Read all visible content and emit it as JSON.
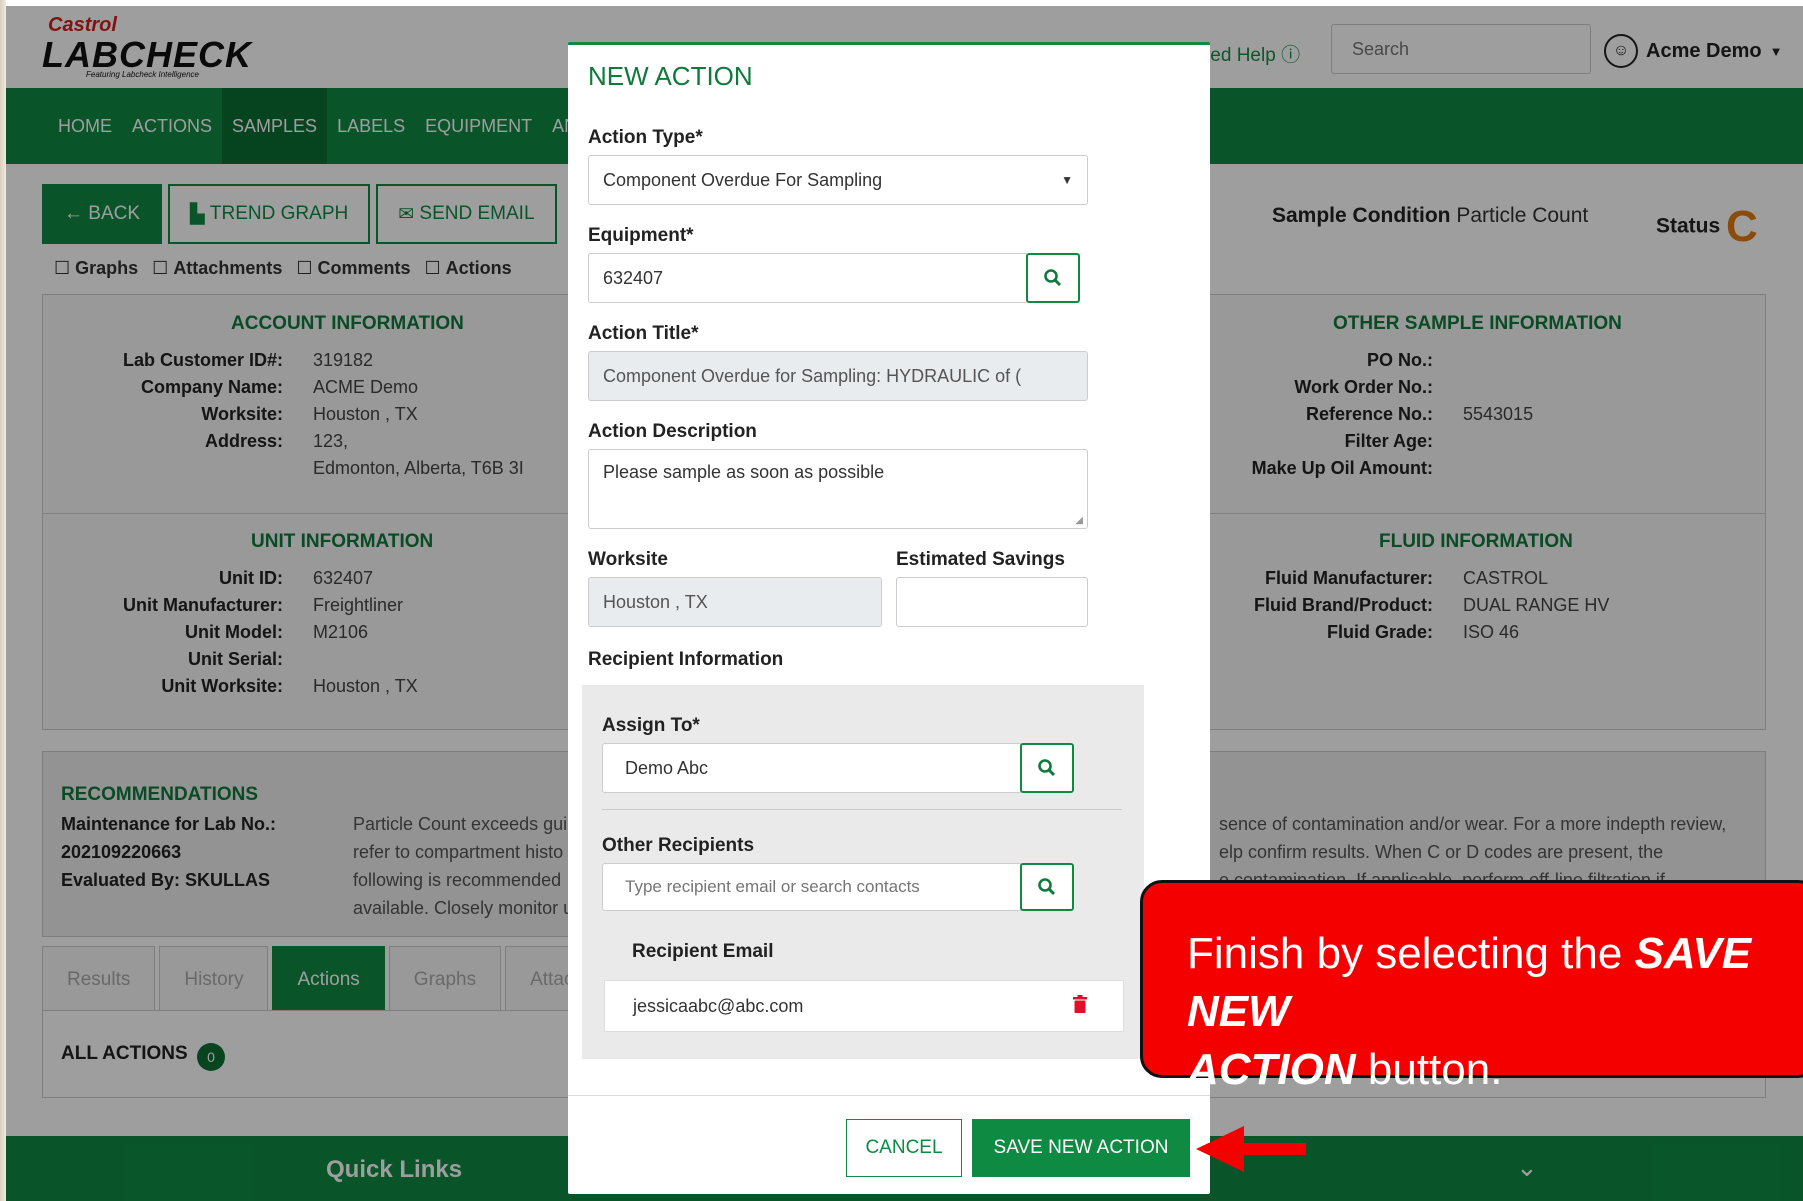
{
  "header": {
    "brand_top": "Castrol",
    "brand_main": "LABCHECK",
    "brand_sub": "Featuring Labcheck Intelligence",
    "help_label": "Need Help",
    "search_placeholder": "Search",
    "user_name": "Acme Demo"
  },
  "nav": {
    "items": [
      "HOME",
      "ACTIONS",
      "SAMPLES",
      "LABELS",
      "EQUIPMENT",
      "ANALY"
    ],
    "active": "SAMPLES"
  },
  "toolbar": {
    "back": "BACK",
    "trend": "TREND GRAPH",
    "email": "SEND EMAIL"
  },
  "filters": {
    "graphs": "Graphs",
    "attachments": "Attachments",
    "comments": "Comments",
    "actions": "Actions"
  },
  "sample": {
    "condition_label": "Sample Condition",
    "condition_value": "Particle Count",
    "status_label": "Status",
    "status_code": "C"
  },
  "account": {
    "title": "ACCOUNT INFORMATION",
    "rows": [
      {
        "k": "Lab Customer ID#:",
        "v": "319182"
      },
      {
        "k": "Company Name:",
        "v": "ACME Demo"
      },
      {
        "k": "Worksite:",
        "v": "Houston , TX"
      },
      {
        "k": "Address:",
        "v": "123,"
      },
      {
        "k": "",
        "v": "Edmonton, Alberta, T6B 3I"
      }
    ]
  },
  "unit": {
    "title": "UNIT INFORMATION",
    "rows": [
      {
        "k": "Unit ID:",
        "v": "632407"
      },
      {
        "k": "Unit Manufacturer:",
        "v": "Freightliner"
      },
      {
        "k": "Unit Model:",
        "v": "M2106"
      },
      {
        "k": "Unit Serial:",
        "v": ""
      },
      {
        "k": "Unit Worksite:",
        "v": "Houston , TX"
      }
    ]
  },
  "other": {
    "title": "OTHER SAMPLE INFORMATION",
    "rows": [
      {
        "k": "PO No.:",
        "v": ""
      },
      {
        "k": "Work Order No.:",
        "v": ""
      },
      {
        "k": "Reference No.:",
        "v": "5543015"
      },
      {
        "k": "Filter Age:",
        "v": ""
      },
      {
        "k": "Make Up Oil Amount:",
        "v": ""
      }
    ]
  },
  "fluid": {
    "title": "FLUID INFORMATION",
    "rows": [
      {
        "k": "Fluid Manufacturer:",
        "v": "CASTROL"
      },
      {
        "k": "Fluid Brand/Product:",
        "v": "DUAL RANGE HV"
      },
      {
        "k": "Fluid Grade:",
        "v": "ISO 46"
      }
    ]
  },
  "recommendations": {
    "title": "RECOMMENDATIONS",
    "maint_label": "Maintenance for Lab No.:",
    "lab_no": "202109220663",
    "evaluated": "Evaluated By: SKULLAS",
    "text_left": [
      "Particle Count exceeds gui",
      "refer to compartment histo",
      "following is recommended",
      "available. Closely monitor u"
    ],
    "text_right": [
      "sence of contamination and/or wear. For a more indepth review,",
      "elp confirm results. When C or D codes are present, the",
      "e contamination. If applicable, perform off-line filtration if"
    ]
  },
  "tabs": [
    "Results",
    "History",
    "Actions",
    "Graphs",
    "Attach"
  ],
  "all_actions": {
    "label": "ALL ACTIONS",
    "count": "0"
  },
  "footer": {
    "quick_links": "Quick Links"
  },
  "modal": {
    "title": "NEW ACTION",
    "action_type_label": "Action Type*",
    "action_type_value": "Component Overdue For Sampling",
    "equipment_label": "Equipment*",
    "equipment_value": "632407",
    "title_label": "Action Title*",
    "title_value": "Component Overdue for Sampling: HYDRAULIC of (",
    "description_label": "Action Description",
    "description_value": "Please sample as soon as possible",
    "worksite_label": "Worksite",
    "worksite_value": "Houston , TX",
    "savings_label": "Estimated Savings",
    "savings_value": "",
    "recipient_section": "Recipient Information",
    "assign_label": "Assign To*",
    "assign_value": "Demo Abc",
    "other_label": "Other Recipients",
    "other_placeholder": "Type recipient email or search contacts",
    "email_header": "Recipient Email",
    "emails": [
      "jessicaabc@abc.com"
    ],
    "cancel": "CANCEL",
    "save": "SAVE NEW ACTION"
  },
  "callout": {
    "line1_plain": "Finish by selecting the ",
    "line1_em": "SAVE NEW",
    "line2_em": "ACTION",
    "line2_plain": " button."
  },
  "colors": {
    "brand_green": "#0f8a43",
    "callout_red": "#f40000",
    "status_orange": "#e07b12"
  }
}
